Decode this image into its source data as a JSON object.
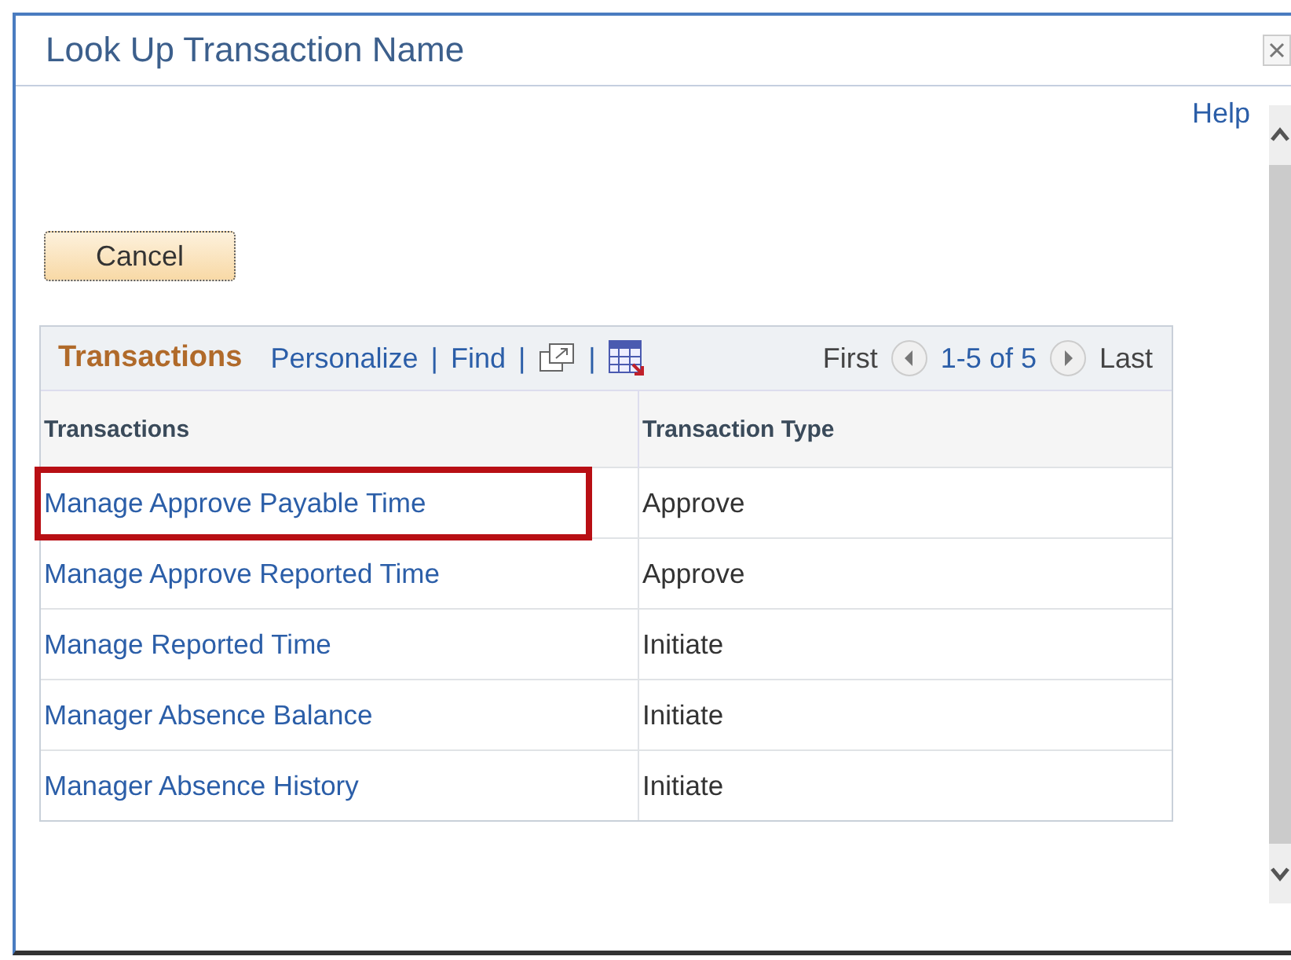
{
  "window": {
    "title": "Look Up Transaction Name"
  },
  "help": "Help",
  "cancel": "Cancel",
  "grid": {
    "title": "Transactions",
    "links": [
      "Personalize",
      "Find"
    ],
    "separator": "|",
    "first": "First",
    "range": "1-5 of 5",
    "last": "Last",
    "columns": [
      "Transactions",
      "Transaction Type"
    ],
    "rows": [
      {
        "name": "Manage Approve Payable Time",
        "type": "Approve",
        "highlighted": true
      },
      {
        "name": "Manage Approve Reported Time",
        "type": "Approve",
        "highlighted": false
      },
      {
        "name": "Manage Reported Time",
        "type": "Initiate",
        "highlighted": false
      },
      {
        "name": "Manager Absence Balance",
        "type": "Initiate",
        "highlighted": false
      },
      {
        "name": "Manager Absence History",
        "type": "Initiate",
        "highlighted": false
      }
    ]
  }
}
